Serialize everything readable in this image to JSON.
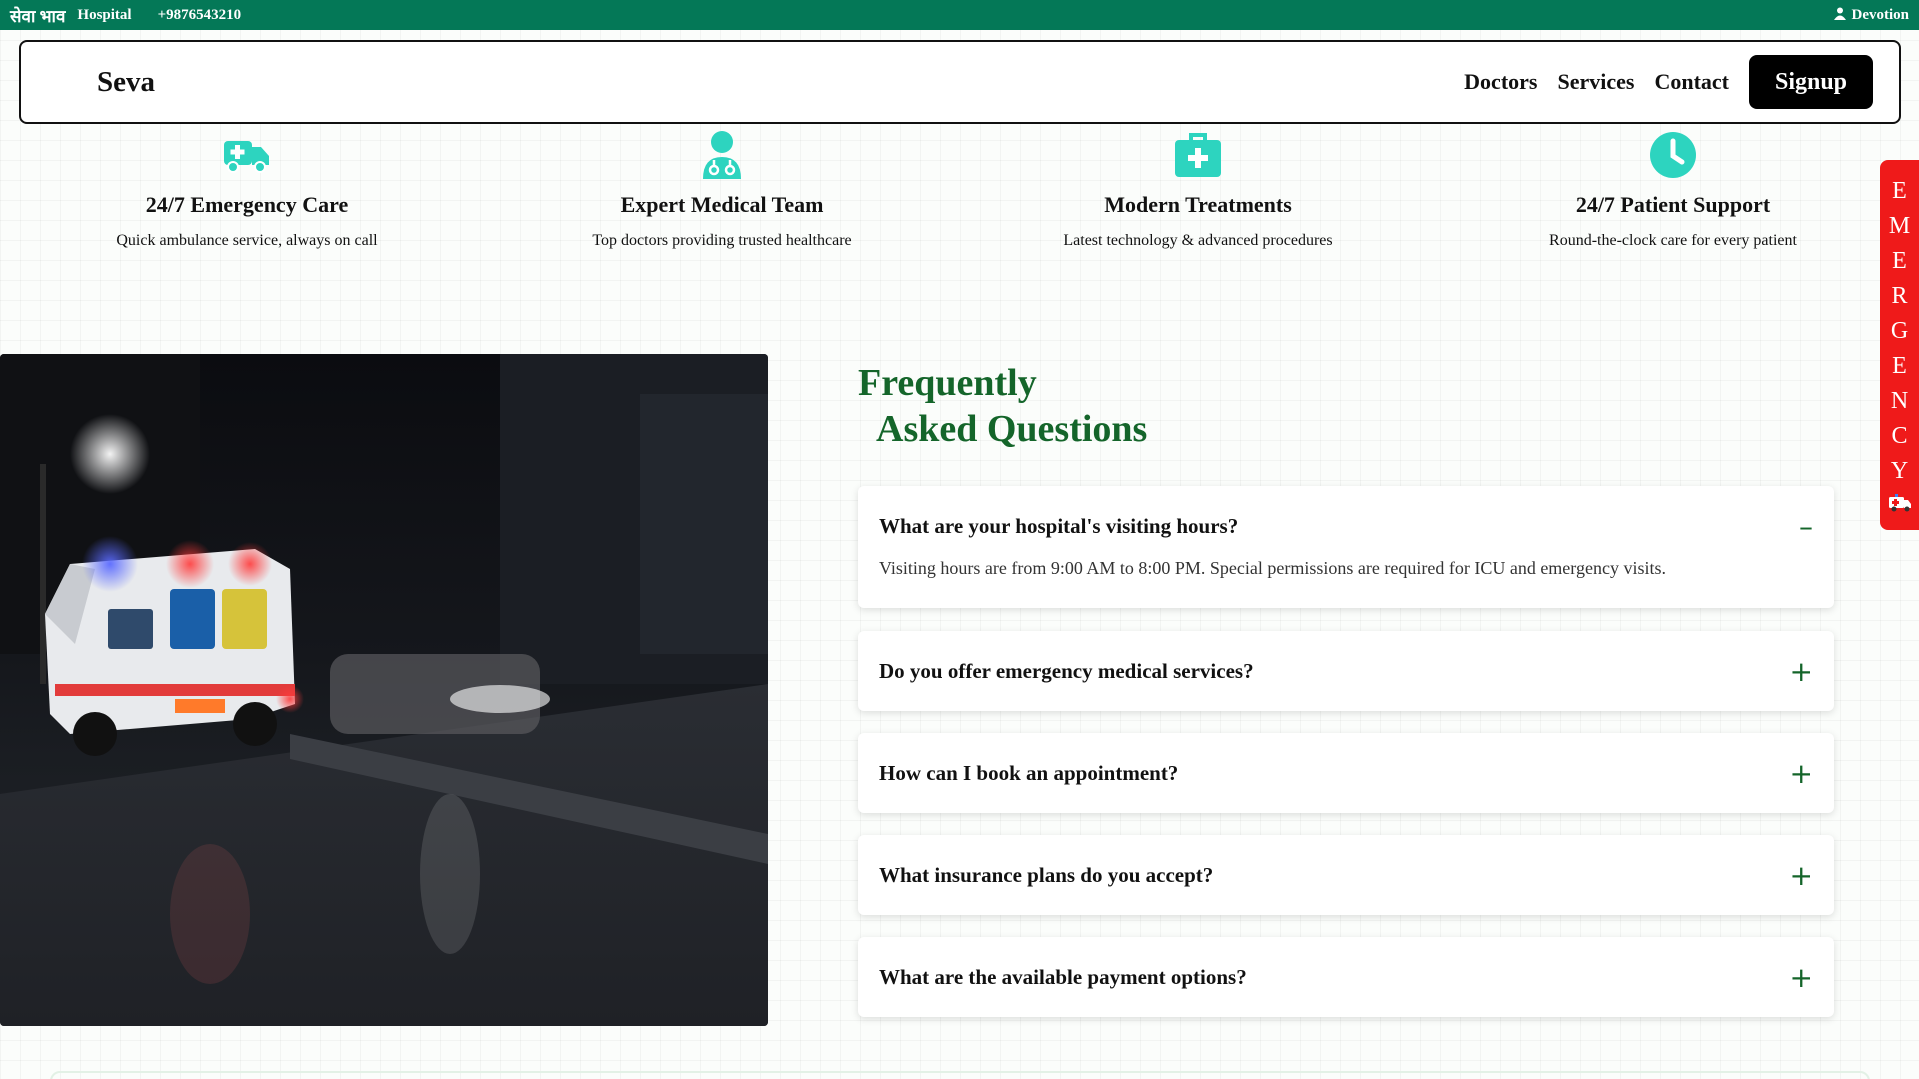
{
  "topbar": {
    "brand_hindi": "सेवा भाव",
    "brand_english": "Hospital",
    "phone": "+9876543210",
    "user_icon": "person-icon",
    "user_name": "Devotion"
  },
  "navbar": {
    "logo": "Seva",
    "links": [
      "Doctors",
      "Services",
      "Contact"
    ],
    "signup_label": "Signup"
  },
  "features": [
    {
      "icon": "ambulance-icon",
      "title": "24/7 Emergency Care",
      "desc": "Quick ambulance service, always on call"
    },
    {
      "icon": "doctor-icon",
      "title": "Expert Medical Team",
      "desc": "Top doctors providing trusted healthcare"
    },
    {
      "icon": "medical-kit-icon",
      "title": "Modern Treatments",
      "desc": "Latest technology & advanced procedures"
    },
    {
      "icon": "clock-icon",
      "title": "24/7 Patient Support",
      "desc": "Round-the-clock care for every patient"
    }
  ],
  "emergency_tab": {
    "letters": [
      "E",
      "M",
      "E",
      "R",
      "G",
      "E",
      "N",
      "C",
      "Y"
    ],
    "icon": "ambulance-icon"
  },
  "faq": {
    "title_line1": "Frequently",
    "title_line2": "Asked Questions",
    "items": [
      {
        "question": "What are your hospital's visiting hours?",
        "answer": "Visiting hours are from 9:00 AM to 8:00 PM. Special permissions are required for ICU and emergency visits.",
        "toggle": "–"
      },
      {
        "question": "Do you offer emergency medical services?",
        "toggle": "+"
      },
      {
        "question": "How can I book an appointment?",
        "toggle": "+"
      },
      {
        "question": "What insurance plans do you accept?",
        "toggle": "+"
      },
      {
        "question": "What are the available payment options?",
        "toggle": "+"
      }
    ]
  },
  "colors": {
    "topbar_bg": "#047857",
    "accent_icon": "#2dd4bf",
    "faq_title": "#14652a",
    "emergency_bg": "#ef1a1a"
  }
}
